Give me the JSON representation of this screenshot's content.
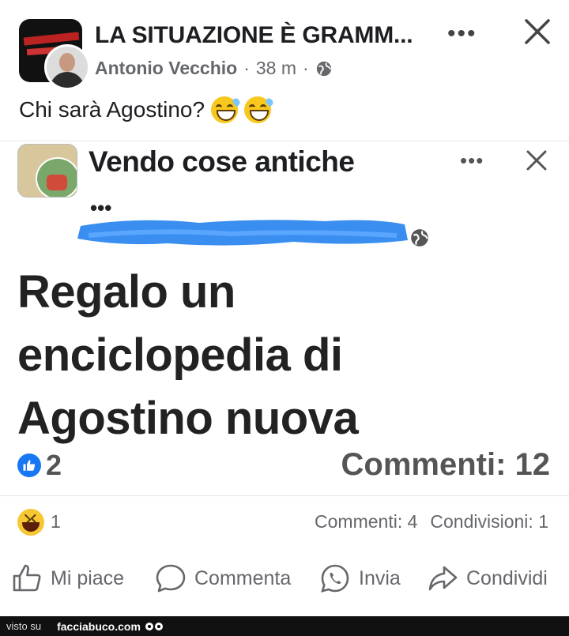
{
  "header": {
    "group_name": "LA SITUAZIONE È GRAMM...",
    "author": "Antonio Vecchio",
    "separator": "·",
    "time": "38 m",
    "more_label": "•••"
  },
  "post": {
    "text": "Chi sarà Agostino?"
  },
  "screenshot": {
    "title": "Vendo cose antiche",
    "more_label": "•••",
    "dots": "•••",
    "body_lines": [
      "Regalo un",
      "enciclopedia di",
      "Agostino nuova"
    ],
    "like_count": "2",
    "comments_text": "Commenti: 12"
  },
  "reactions": {
    "count": "1",
    "comments": "Commenti: 4",
    "shares": "Condivisioni: 1"
  },
  "actions": {
    "like": "Mi piace",
    "comment": "Commenta",
    "send": "Invia",
    "share": "Condividi"
  },
  "footer": {
    "visto": "visto su",
    "brand": "facciabuco.com"
  },
  "colors": {
    "text": "#1c1e21",
    "secondary": "#65676b",
    "like_blue": "#1877f2",
    "redaction_blue": "#3a8ef0"
  }
}
